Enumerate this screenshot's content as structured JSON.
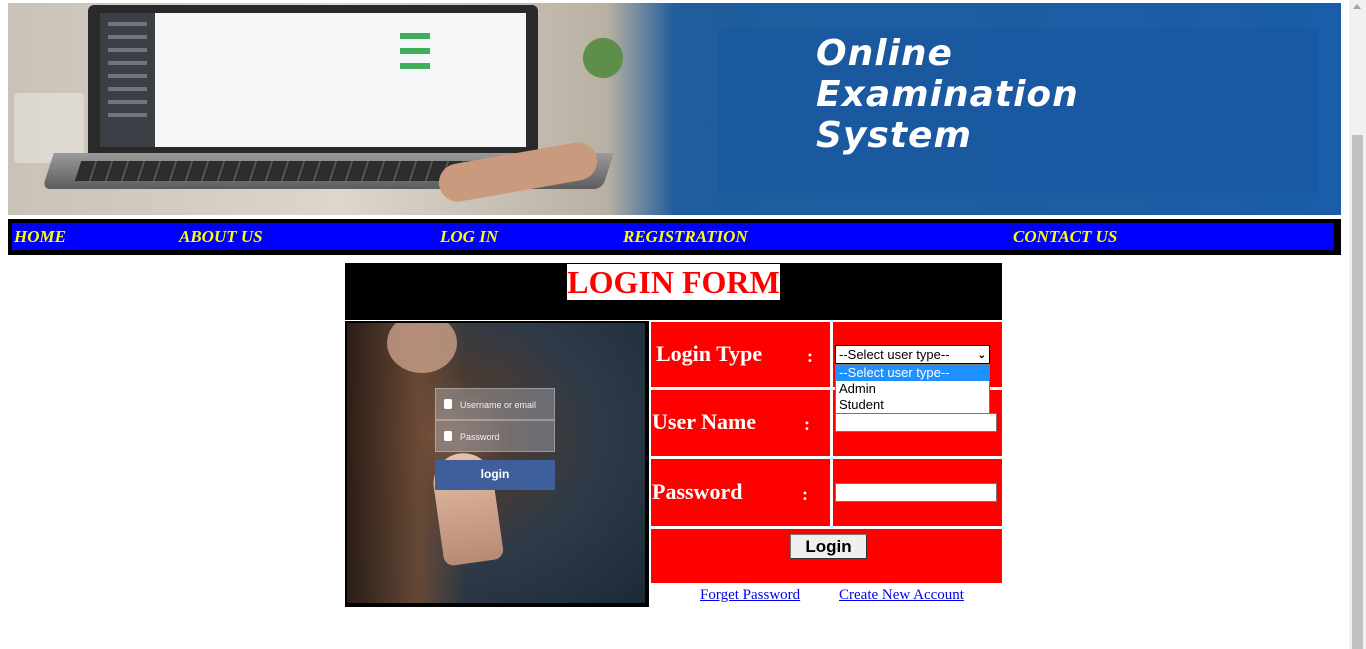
{
  "banner": {
    "title_lines": [
      "Online",
      "Examination",
      "System"
    ]
  },
  "nav": {
    "items": [
      {
        "label": "HOME"
      },
      {
        "label": "ABOUT US"
      },
      {
        "label": "LOG IN"
      },
      {
        "label": "REGISTRATION"
      },
      {
        "label": "CONTACT US"
      }
    ]
  },
  "login_form": {
    "title": "LOGIN FORM",
    "image": {
      "username_placeholder": "Username or email",
      "password_placeholder": "Password",
      "button_label": "login"
    },
    "fields": {
      "login_type_label": "Login Type",
      "user_name_label": "User Name",
      "password_label": "Password",
      "colon": ":"
    },
    "user_type": {
      "selected": "--Select user type--",
      "options": [
        "--Select user type--",
        "Admin",
        "Student"
      ]
    },
    "user_name_value": "",
    "password_value": "",
    "login_button": "Login",
    "links": {
      "forget_password": "Forget Password",
      "create_account": "Create New Account"
    }
  },
  "colors": {
    "nav_bg": "#0000ff",
    "nav_text": "#ffff00",
    "form_red": "#ff0000",
    "title_red": "#ff0000"
  },
  "icons": {
    "dropdown_arrow": "chevron-down-icon"
  }
}
